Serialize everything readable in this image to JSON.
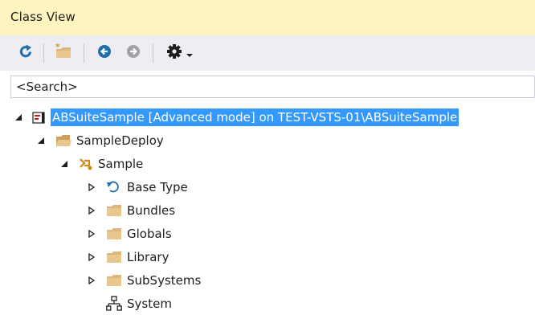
{
  "panel": {
    "title": "Class View"
  },
  "toolbar": {
    "buttons": [
      {
        "icon": "refresh-icon"
      },
      {
        "icon": "new-folder-icon"
      },
      {
        "icon": "back-arrow-icon"
      },
      {
        "icon": "forward-arrow-icon"
      },
      {
        "icon": "settings-gear-icon"
      }
    ]
  },
  "search": {
    "placeholder": "<Search>"
  },
  "tree": {
    "root": "ABSuiteSample [Advanced mode] on TEST-VSTS-01\\ABSuiteSample",
    "deploy": "SampleDeploy",
    "sample": "Sample",
    "children": [
      {
        "label": "Base Type",
        "icon": "base-type-icon"
      },
      {
        "label": "Bundles",
        "icon": "folder-icon"
      },
      {
        "label": "Globals",
        "icon": "folder-icon"
      },
      {
        "label": "Library",
        "icon": "folder-icon"
      },
      {
        "label": "SubSystems",
        "icon": "folder-icon"
      },
      {
        "label": "System",
        "icon": "hierarchy-icon"
      }
    ]
  },
  "colors": {
    "title_background": "#fdf4bf",
    "toolbar_background": "#eeeef2",
    "selection": "#3399ff",
    "folder": "#dcb67a",
    "toolbar_icon": "#1e6fb0",
    "toolbar_icon_disabled": "#a0a0a8"
  }
}
